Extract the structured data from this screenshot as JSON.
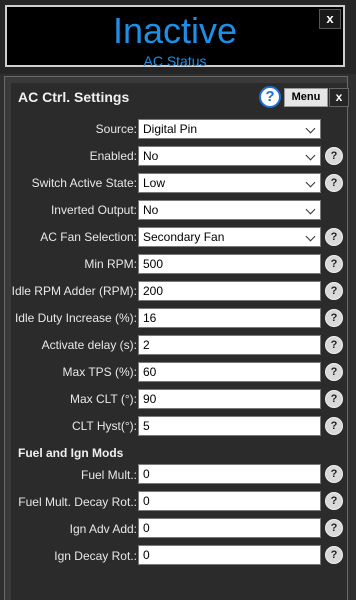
{
  "status": {
    "value": "Inactive",
    "caption": "AC Status",
    "close_label": "x"
  },
  "panel": {
    "title": "AC Ctrl. Settings",
    "help_label": "?",
    "menu_label": "Menu",
    "close_label": "x"
  },
  "settings": {
    "source": {
      "label": "Source:",
      "value": "Digital Pin"
    },
    "enabled": {
      "label": "Enabled:",
      "value": "No"
    },
    "switch_state": {
      "label": "Switch Active State:",
      "value": "Low"
    },
    "inverted": {
      "label": "Inverted Output:",
      "value": "No"
    },
    "fan": {
      "label": "AC Fan Selection:",
      "value": "Secondary Fan"
    },
    "min_rpm": {
      "label": "Min RPM:",
      "value": "500"
    },
    "idle_adder": {
      "label": "Idle RPM Adder (RPM):",
      "value": "200"
    },
    "idle_duty": {
      "label": "Idle Duty Increase (%):",
      "value": "16"
    },
    "delay": {
      "label": "Activate delay (s):",
      "value": "2"
    },
    "max_tps": {
      "label": "Max TPS (%):",
      "value": "60"
    },
    "max_clt": {
      "label": "Max CLT (°):",
      "value": "90"
    },
    "clt_hyst": {
      "label": "CLT Hyst(°):",
      "value": "5"
    }
  },
  "mods": {
    "title": "Fuel and Ign Mods",
    "fuel_mult": {
      "label": "Fuel Mult.:",
      "value": "0"
    },
    "fuel_decay": {
      "label": "Fuel Mult. Decay Rot.:",
      "value": "0"
    },
    "ign_adv": {
      "label": "Ign Adv Add:",
      "value": "0"
    },
    "ign_decay": {
      "label": "Ign Decay Rot.:",
      "value": "0"
    }
  },
  "help_small_label": "?",
  "colors": {
    "accent": "#1e8fe6",
    "background": "#2b2b2b",
    "field": "#ffffff"
  }
}
